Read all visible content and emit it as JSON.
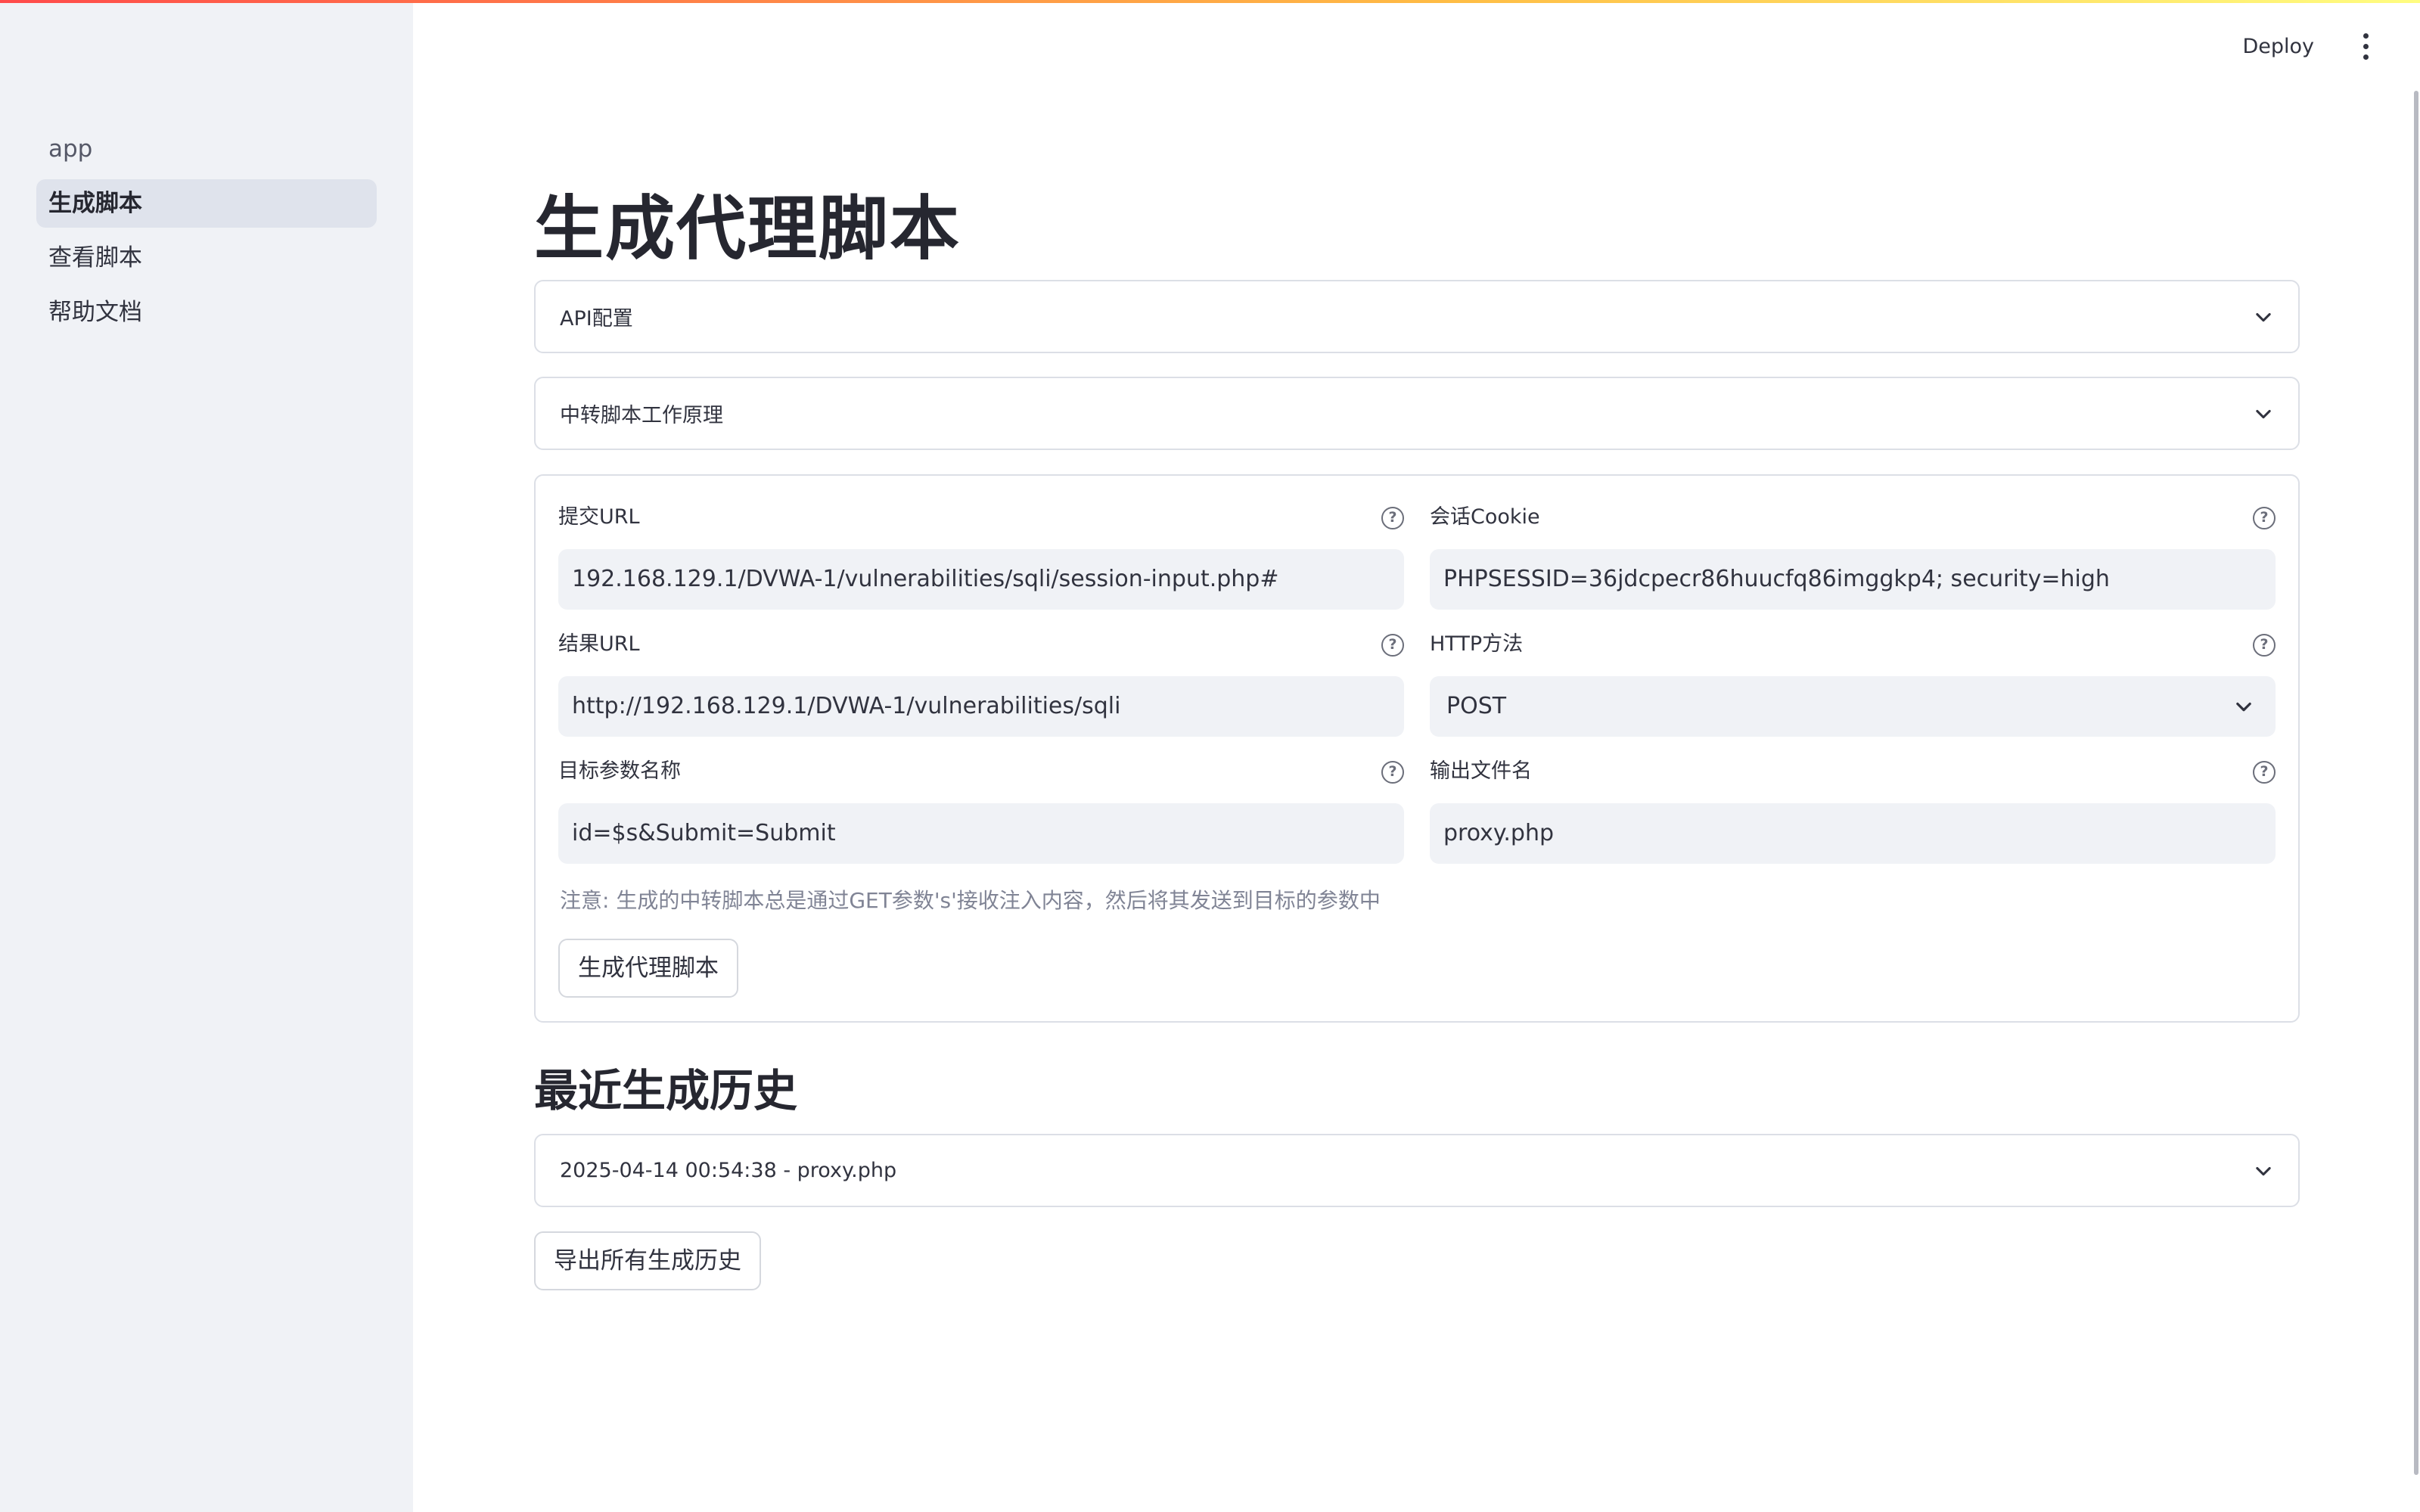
{
  "app": {
    "accent_gradient": [
      "#ff4b4b",
      "#ffbd45",
      "#fffd80"
    ]
  },
  "sidebar": {
    "items": [
      {
        "label": "app"
      },
      {
        "label": "生成脚本",
        "active": true
      },
      {
        "label": "查看脚本"
      },
      {
        "label": "帮助文档"
      }
    ]
  },
  "header": {
    "deploy_label": "Deploy",
    "menu_icon": "kebab-menu-icon"
  },
  "main": {
    "title": "生成代理脚本",
    "expanders": [
      {
        "label": "API配置"
      },
      {
        "label": "中转脚本工作原理"
      }
    ],
    "form": {
      "submit_url": {
        "label": "提交URL",
        "value": "192.168.129.1/DVWA-1/vulnerabilities/sqli/session-input.php#"
      },
      "cookie": {
        "label": "会话Cookie",
        "value": "PHPSESSID=36jdcpecr86huucfq86imggkp4; security=high"
      },
      "result_url": {
        "label": "结果URL",
        "value": "http://192.168.129.1/DVWA-1/vulnerabilities/sqli"
      },
      "http_method": {
        "label": "HTTP方法",
        "value": "POST"
      },
      "target_param": {
        "label": "目标参数名称",
        "value": "id=$s&Submit=Submit"
      },
      "output_file": {
        "label": "输出文件名",
        "value": "proxy.php"
      },
      "note": "注意: 生成的中转脚本总是通过GET参数's'接收注入内容，然后将其发送到目标的参数中",
      "generate_button": "生成代理脚本",
      "help_icon_glyph": "?"
    },
    "history": {
      "title": "最近生成历史",
      "items": [
        {
          "label": "2025-04-14 00:54:38 - proxy.php"
        }
      ],
      "export_button": "导出所有生成历史"
    }
  }
}
